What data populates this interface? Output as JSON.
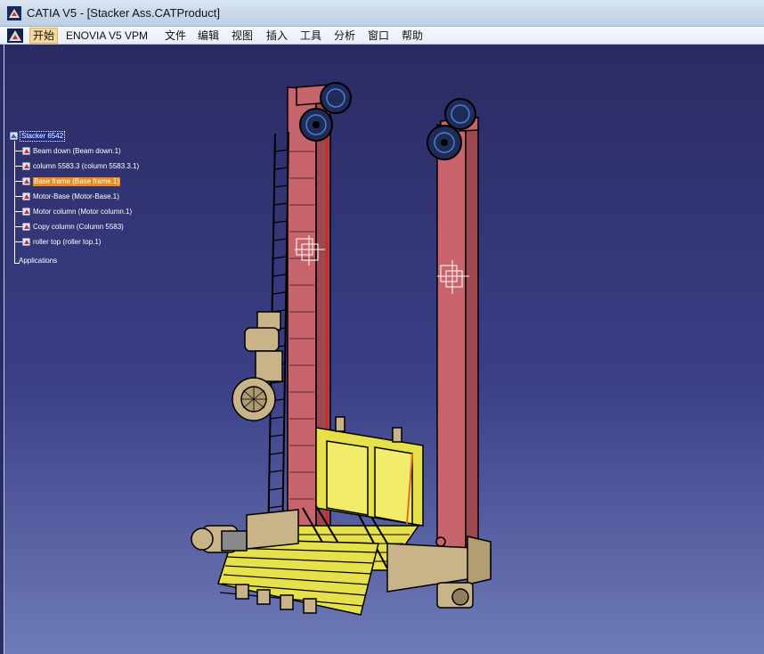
{
  "window": {
    "title": "CATIA V5 - [Stacker Ass.CATProduct]"
  },
  "menu": {
    "items": [
      "开始",
      "ENOVIA V5 VPM",
      "文件",
      "编辑",
      "视图",
      "插入",
      "工具",
      "分析",
      "窗口",
      "帮助"
    ],
    "active_index": 0
  },
  "tree": {
    "root": "Stacker 6542",
    "children": [
      "Beam down (Beam down.1)",
      "column 5583.3 (column 5583.3.1)",
      "Base frame (Base frame.1)",
      "Motor-Base (Motor-Base.1)",
      "Motor column (Motor column.1)",
      "Copy column (Column 5583)",
      "roller top (roller top.1)"
    ],
    "selected_index": 2,
    "footer": "Applications"
  },
  "colors": {
    "viewport_top": "#2b2a63",
    "viewport_bottom": "#6f7bb8",
    "column": "#c8646c",
    "base_frame": "#e6e04a",
    "selection": "#ea8a1a",
    "tan_parts": "#c9b48a"
  },
  "icons": [
    "catia-app-icon",
    "catia-menu-icon",
    "product-node-icon",
    "part-node-icon",
    "applications-branch-icon"
  ]
}
